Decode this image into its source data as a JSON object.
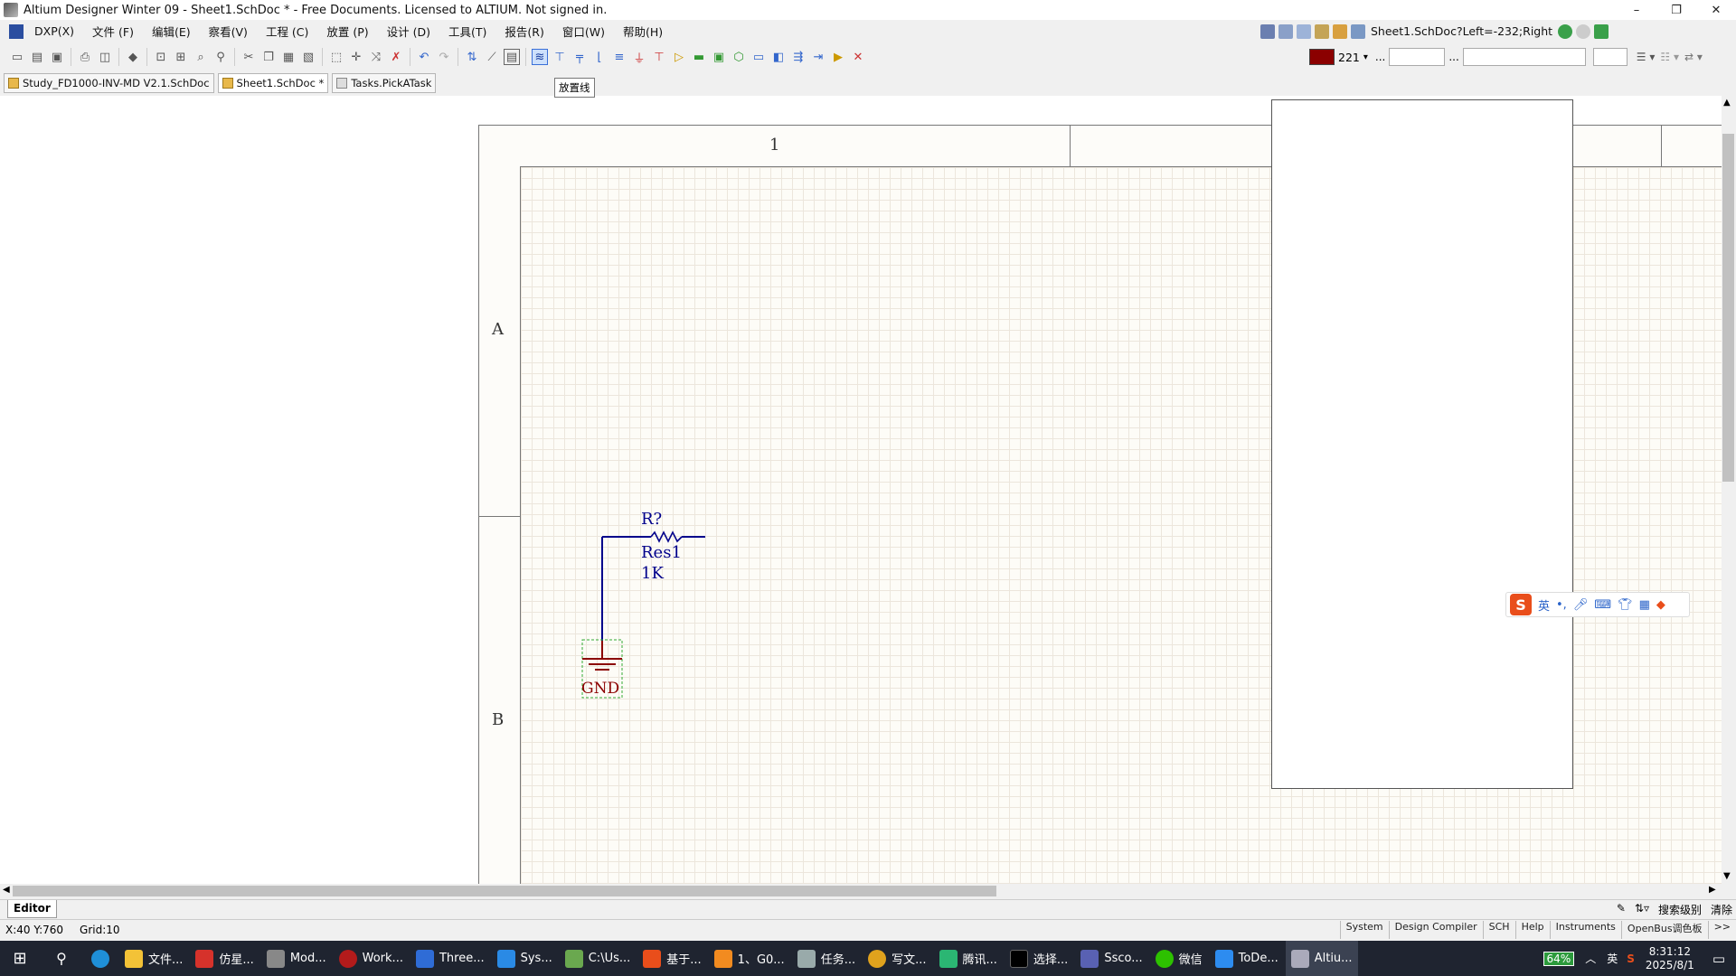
{
  "window": {
    "title": "Altium Designer Winter 09 - Sheet1.SchDoc * - Free Documents. Licensed to ALTIUM. Not signed in.",
    "controls": [
      "–",
      "❐",
      "✕"
    ]
  },
  "menu": {
    "items": [
      "DXP(X)",
      "文件 (F)",
      "编辑(E)",
      "察看(V)",
      "工程 (C)",
      "放置 (P)",
      "设计 (D)",
      "工具(T)",
      "报告(R)",
      "窗口(W)",
      "帮助(H)"
    ]
  },
  "location_box": "Sheet1.SchDoc?Left=-232;Right",
  "format": {
    "color_hex": "#8b0000",
    "color_index": "221",
    "ellipsis1": "...",
    "ellipsis2": "..."
  },
  "tabs": [
    {
      "label": "Study_FD1000-INV-MD V2.1.SchDoc",
      "active": false
    },
    {
      "label": "Sheet1.SchDoc *",
      "active": true
    },
    {
      "label": "Tasks.PickATask",
      "active": false
    }
  ],
  "tooltip": "放置线",
  "sheet": {
    "col_labels": [
      "1"
    ],
    "row_labels": [
      "A",
      "B"
    ]
  },
  "component": {
    "designator": "R?",
    "comment": "Res1",
    "value": "1K",
    "ground_label": "GND",
    "wire_color": "#00008b",
    "ground_color": "#8b0000"
  },
  "ime": {
    "logo": "S",
    "lang": "英",
    "icons": [
      "punct-icon",
      "mic-icon",
      "keyboard-icon",
      "skin-icon",
      "apps-icon",
      "more-icon"
    ]
  },
  "editor_tab": "Editor",
  "editor_right": [
    "搜索级别",
    "清除"
  ],
  "status": {
    "coords": "X:40 Y:760",
    "grid": "Grid:10"
  },
  "panel_buttons": [
    "System",
    "Design Compiler",
    "SCH",
    "Help",
    "Instruments",
    "OpenBus调色板",
    ">>"
  ],
  "taskbar": {
    "items": [
      "文件...",
      "仿星...",
      "Mod...",
      "Work...",
      "Three...",
      "Sys...",
      "C:\\Us...",
      "基于...",
      "1、G0...",
      "任务...",
      "写文...",
      "腾讯...",
      "选择...",
      "Ssco...",
      "微信",
      "ToDe...",
      "Altiu..."
    ],
    "battery": "64%",
    "ime": "英",
    "time": "8:31:12",
    "date": "2025/8/1"
  }
}
